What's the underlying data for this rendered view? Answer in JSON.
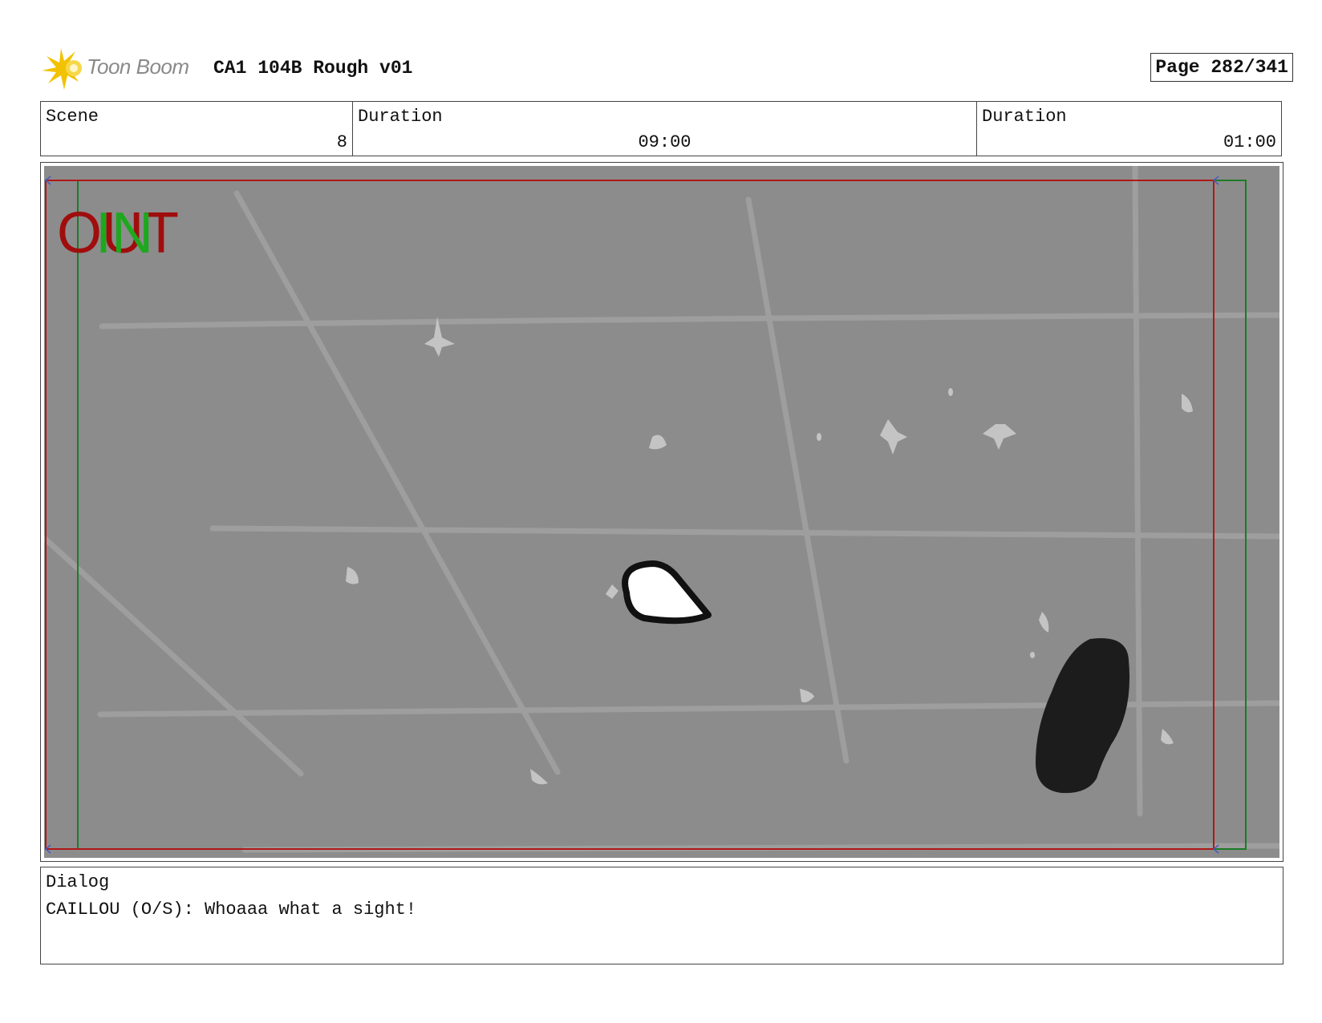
{
  "header": {
    "brand": "Toon Boom",
    "project_title": "CA1 104B Rough v01",
    "page": "Page 282/341"
  },
  "info": {
    "scene_label": "Scene",
    "scene_value": "8",
    "duration_label_1": "Duration",
    "duration_value_1": "09:00",
    "duration_label_2": "Duration",
    "duration_value_2": "01:00"
  },
  "panel": {
    "out_marker": "OUT",
    "in_marker": "IN",
    "colors": {
      "background": "#8c8c8c",
      "grid": "#9e9e9e",
      "stars": "#c4c4c4",
      "out_frame": "#b01818",
      "in_frame": "#1d7a26",
      "out_text": "#a00d0d",
      "in_text": "#1ea81e"
    }
  },
  "dialog": {
    "label": "Dialog",
    "text": "CAILLOU (O/S): Whoaaa what a sight!"
  },
  "icons": {
    "logo": "toon-boom-starburst-icon"
  }
}
